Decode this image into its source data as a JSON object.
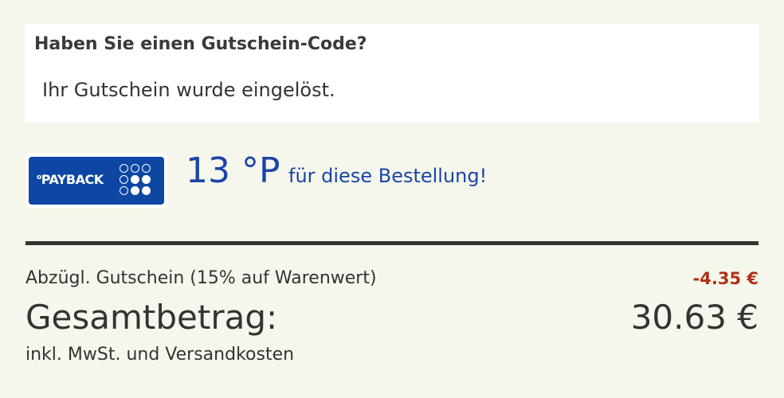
{
  "coupon": {
    "heading": "Haben Sie einen Gutschein-Code?",
    "status": "Ihr Gutschein wurde eingelöst."
  },
  "payback": {
    "logo_text": "PAYBACK",
    "points": "13 °P",
    "points_text": "für diese Bestellung!",
    "brand_color": "#0e47a3",
    "text_color": "#1b45a6"
  },
  "summary": {
    "discount_label": "Abzügl. Gutschein (15% auf Warenwert)",
    "discount_amount": "-4.35 €",
    "total_label": "Gesamtbetrag:",
    "total_amount": "30.63 €",
    "tax_note": "inkl. MwSt. und Versandkosten",
    "discount_color": "#b03018"
  }
}
